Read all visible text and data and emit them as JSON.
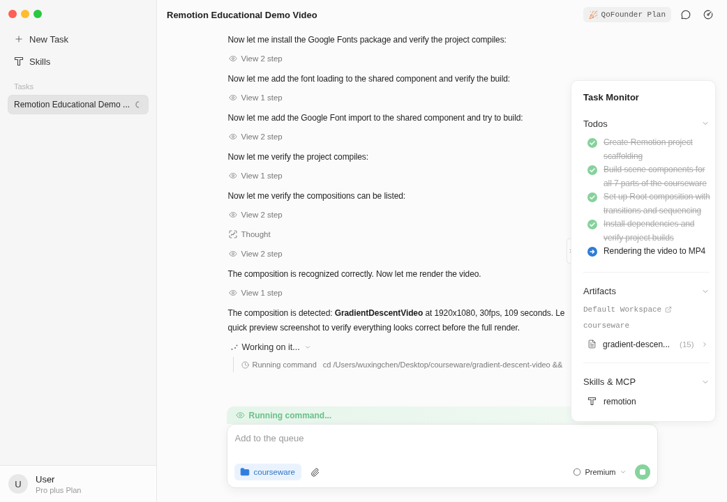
{
  "sidebar": {
    "nav": [
      {
        "kind": "new",
        "label": "New Task"
      },
      {
        "kind": "skills",
        "label": "Skills"
      }
    ],
    "tasks_label": "Tasks",
    "tasks": [
      {
        "title": "Remotion Educational Demo ...",
        "selected": true,
        "running": true
      }
    ],
    "user": {
      "initial": "U",
      "name": "User",
      "plan": "Pro plus Plan"
    }
  },
  "header": {
    "title": "Remotion Educational Demo Video",
    "plan": "QoFounder Plan"
  },
  "chat": {
    "entries": [
      {
        "kind": "message",
        "text": "Now let me install the Google Fonts package and verify the project compiles:"
      },
      {
        "kind": "steps",
        "label": "View 2 step"
      },
      {
        "kind": "message",
        "text": "Now let me add the font loading to the shared component and verify the build:"
      },
      {
        "kind": "steps",
        "label": "View 1 step"
      },
      {
        "kind": "message",
        "text": "Now let me add the Google Font import to the shared component and try to build:"
      },
      {
        "kind": "steps",
        "label": "View 2 step"
      },
      {
        "kind": "message",
        "text": "Now let me verify the project compiles:"
      },
      {
        "kind": "steps",
        "label": "View 1 step"
      },
      {
        "kind": "message",
        "text": "Now let me verify the compositions can be listed:"
      },
      {
        "kind": "steps",
        "label": "View 2 step"
      },
      {
        "kind": "thought",
        "label": "Thought"
      },
      {
        "kind": "steps",
        "label": "View 2 step"
      },
      {
        "kind": "message",
        "text": "The composition is recognized correctly. Now let me render the video."
      },
      {
        "kind": "steps",
        "label": "View 1 step"
      },
      {
        "kind": "message",
        "lines": [
          "The composition is detected: **GradientDescentVideo** at 1920x1080, 30fps, 109 seconds. Le",
          "quick preview screenshot to verify everything looks correct before the full render."
        ]
      },
      {
        "kind": "working",
        "label": "Working on it...",
        "expanded": true,
        "command_label": "Running command",
        "command": "cd /Users/wuxingchen/Desktop/courseware/gradient-descent-video &&"
      }
    ]
  },
  "status_banner": {
    "text": "Running command..."
  },
  "composer": {
    "placeholder": "Add to the queue",
    "folder": "courseware",
    "model": "Premium",
    "running": true
  },
  "task_monitor": {
    "title": "Task Monitor",
    "todos": {
      "title": "Todos",
      "expanded": true,
      "items": [
        {
          "text": "Create Remotion project scaffolding",
          "done": true
        },
        {
          "text": "Build scene components for all 7 parts of the courseware",
          "done": true
        },
        {
          "text": "Set up Root composition with transitions and sequencing",
          "done": true
        },
        {
          "text": "Install dependencies and verify project builds",
          "done": true
        },
        {
          "text": "Rendering the video to MP4",
          "done": false
        }
      ]
    },
    "artifacts": {
      "title": "Artifacts",
      "expanded": true,
      "workspace": "Default Workspace",
      "folder": "courseware",
      "files": [
        {
          "name": "gradient-descen...",
          "count": "(15)"
        }
      ]
    },
    "skills": {
      "title": "Skills & MCP",
      "expanded": true,
      "items": [
        {
          "name": "remotion"
        }
      ]
    }
  }
}
